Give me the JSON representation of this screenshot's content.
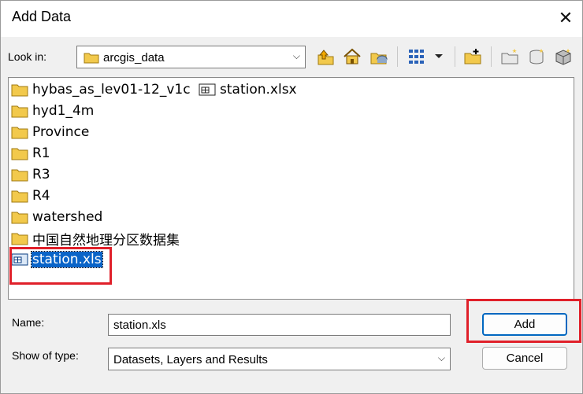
{
  "window": {
    "title": "Add Data"
  },
  "lookin": {
    "label": "Look in:",
    "value": "arcgis_data"
  },
  "toolbar": {
    "icons": [
      "up-one-level-icon",
      "home-icon",
      "catalog-connections-icon",
      "list-view-icon",
      "view-dropdown-icon",
      "connect-folder-icon",
      "new-folder-icon",
      "new-geodatabase-icon",
      "new-toolbox-icon"
    ]
  },
  "files": [
    {
      "label": "hybas_as_lev01-12_v1c",
      "type": "folder"
    },
    {
      "label": "station.xlsx",
      "type": "table"
    },
    {
      "label": "hyd1_4m",
      "type": "folder"
    },
    {
      "label": "Province",
      "type": "folder"
    },
    {
      "label": "R1",
      "type": "folder"
    },
    {
      "label": "R3",
      "type": "folder"
    },
    {
      "label": "R4",
      "type": "folder"
    },
    {
      "label": "watershed",
      "type": "folder"
    },
    {
      "label": "中国自然地理分区数据集",
      "type": "folder"
    },
    {
      "label": "station.xls",
      "type": "table",
      "selected": true
    }
  ],
  "name_field": {
    "label": "Name:",
    "value": "station.xls"
  },
  "type_field": {
    "label": "Show of type:",
    "value": "Datasets, Layers and Results"
  },
  "buttons": {
    "add": "Add",
    "cancel": "Cancel"
  },
  "colors": {
    "highlight": "#e0202a",
    "selection": "#0a64c8",
    "folder": "#f2c94c"
  }
}
